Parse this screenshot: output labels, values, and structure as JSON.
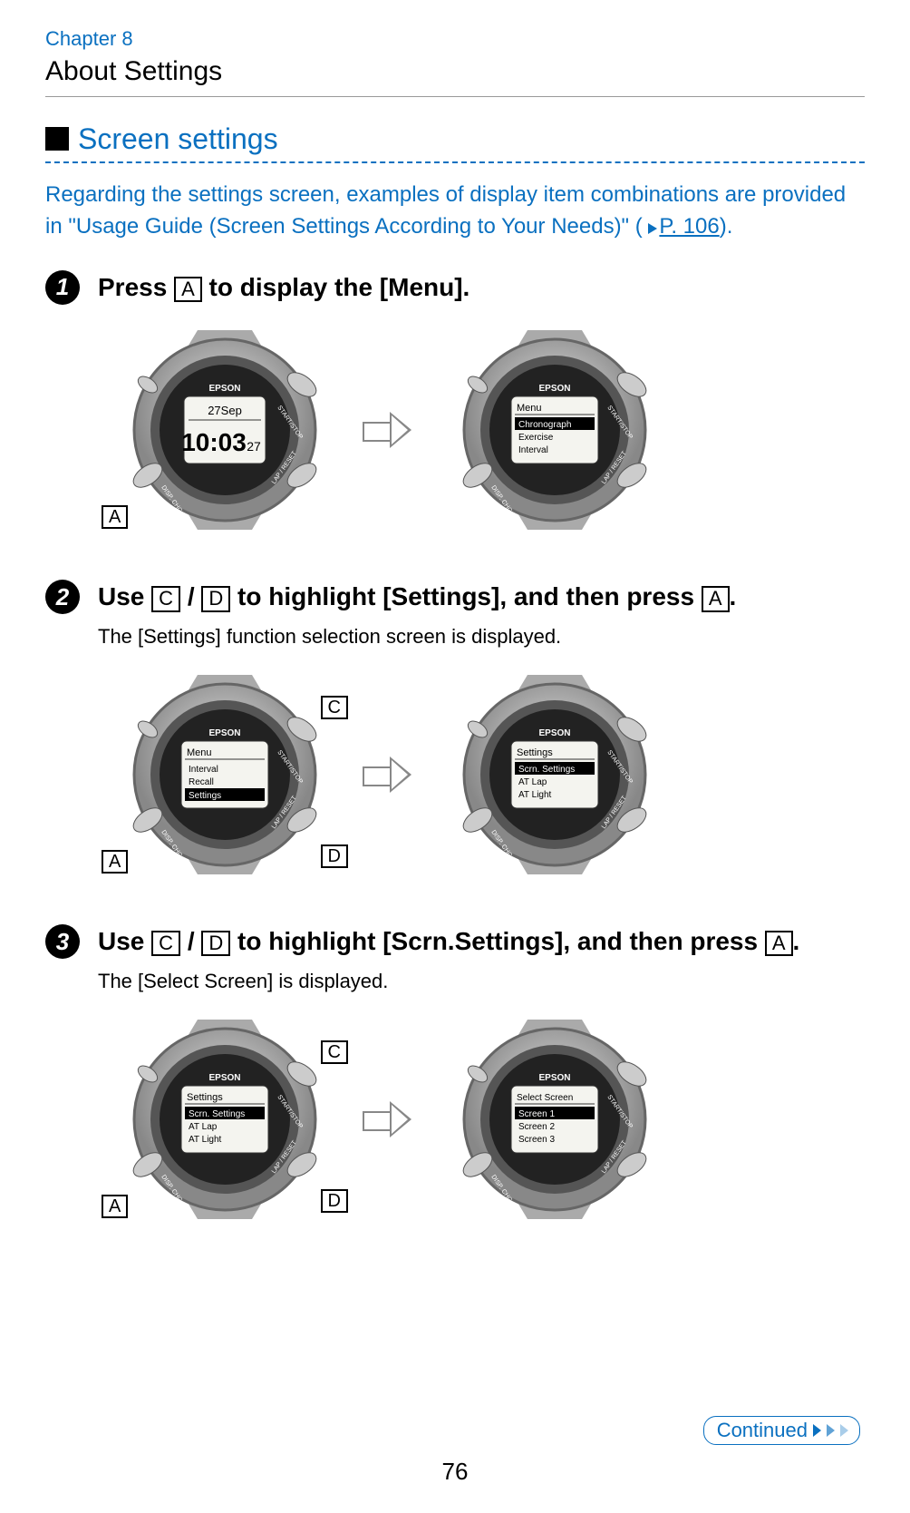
{
  "chapter": "Chapter 8",
  "about": "About Settings",
  "section": "Screen settings",
  "intro_pre": "Regarding the settings screen, examples of display item combinations are provided in \"Usage Guide (Screen Settings According to Your Needs)\" (",
  "intro_link": "P. 106",
  "intro_post": ").",
  "keys": {
    "A": "A",
    "C": "C",
    "D": "D"
  },
  "steps": {
    "1": {
      "num": "1",
      "t_pre": "Press ",
      "t_post": " to display the [Menu].",
      "w1": {
        "brand": "EPSON",
        "line1": "27Sep",
        "line2a": "10:03",
        "line2b": "27"
      },
      "w2": {
        "brand": "EPSON",
        "title": "Menu",
        "items": [
          "Chronograph",
          "Exercise",
          "Interval"
        ],
        "selected": 0
      }
    },
    "2": {
      "num": "2",
      "t_pre": "Use ",
      "t_mid": " / ",
      "t_mid2": " to highlight [Settings], and then press ",
      "t_post": ".",
      "sub": "The [Settings] function selection screen is displayed.",
      "w1": {
        "brand": "EPSON",
        "title": "Menu",
        "items": [
          "Interval",
          "Recall",
          "Settings"
        ],
        "selected": 2
      },
      "w2": {
        "brand": "EPSON",
        "title": "Settings",
        "items": [
          "Scrn. Settings",
          "AT Lap",
          "AT Light"
        ],
        "selected": 0
      }
    },
    "3": {
      "num": "3",
      "t_pre": "Use ",
      "t_mid": " / ",
      "t_mid2": " to highlight [Scrn.Settings], and then press ",
      "t_post": ".",
      "sub": "The [Select Screen] is displayed.",
      "w1": {
        "brand": "EPSON",
        "title": "Settings",
        "items": [
          "Scrn. Settings",
          "AT Lap",
          "AT Light"
        ],
        "selected": 0
      },
      "w2": {
        "brand": "EPSON",
        "title": "Select Screen",
        "items": [
          "Screen 1",
          "Screen 2",
          "Screen 3"
        ],
        "selected": 0
      }
    }
  },
  "continued": "Continued",
  "page": "76"
}
